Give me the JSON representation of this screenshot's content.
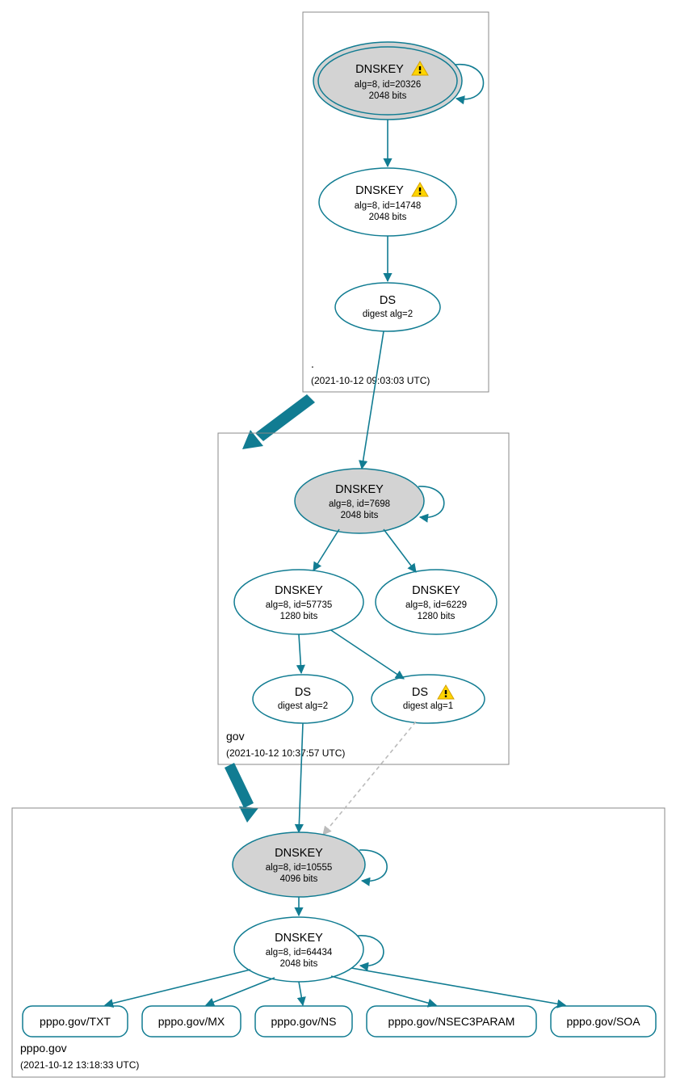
{
  "colors": {
    "teal": "#117c92",
    "grey_fill": "#d3d3d3"
  },
  "zones": {
    "root": {
      "name": ".",
      "timestamp": "(2021-10-12 09:03:03 UTC)"
    },
    "gov": {
      "name": "gov",
      "timestamp": "(2021-10-12 10:37:57 UTC)"
    },
    "pppo": {
      "name": "pppo.gov",
      "timestamp": "(2021-10-12 13:18:33 UTC)"
    }
  },
  "nodes": {
    "root_ksk": {
      "title": "DNSKEY",
      "line1": "alg=8, id=20326",
      "line2": "2048 bits",
      "warn": true
    },
    "root_zsk": {
      "title": "DNSKEY",
      "line1": "alg=8, id=14748",
      "line2": "2048 bits",
      "warn": true
    },
    "root_ds": {
      "title": "DS",
      "line1": "digest alg=2"
    },
    "gov_ksk": {
      "title": "DNSKEY",
      "line1": "alg=8, id=7698",
      "line2": "2048 bits"
    },
    "gov_zsk1": {
      "title": "DNSKEY",
      "line1": "alg=8, id=57735",
      "line2": "1280 bits"
    },
    "gov_zsk2": {
      "title": "DNSKEY",
      "line1": "alg=8, id=6229",
      "line2": "1280 bits"
    },
    "gov_ds1": {
      "title": "DS",
      "line1": "digest alg=2"
    },
    "gov_ds2": {
      "title": "DS",
      "line1": "digest alg=1",
      "warn": true
    },
    "pppo_ksk": {
      "title": "DNSKEY",
      "line1": "alg=8, id=10555",
      "line2": "4096 bits"
    },
    "pppo_zsk": {
      "title": "DNSKEY",
      "line1": "alg=8, id=64434",
      "line2": "2048 bits"
    }
  },
  "rrsets": {
    "txt": "pppo.gov/TXT",
    "mx": "pppo.gov/MX",
    "ns": "pppo.gov/NS",
    "nsec": "pppo.gov/NSEC3PARAM",
    "soa": "pppo.gov/SOA"
  }
}
